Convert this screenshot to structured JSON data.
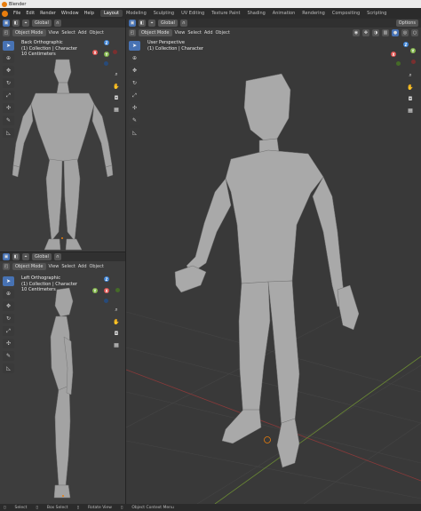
{
  "titlebar": {
    "title": "Blender"
  },
  "menu": [
    "File",
    "Edit",
    "Render",
    "Window",
    "Help"
  ],
  "workspaces": [
    "Layout",
    "Modeling",
    "Sculpting",
    "UV Editing",
    "Texture Paint",
    "Shading",
    "Animation",
    "Rendering",
    "Compositing",
    "Scripting"
  ],
  "active_workspace": "Layout",
  "header": {
    "orientation": "Global",
    "mode": "Object Mode",
    "view": "View",
    "select": "Select",
    "add": "Add",
    "object": "Object",
    "options": "Options"
  },
  "viewports": {
    "back": {
      "name": "Back Orthographic",
      "collection": "(1) Collection | Character",
      "scale": "10 Centimeters"
    },
    "left": {
      "name": "Left Orthographic",
      "collection": "(1) Collection | Character",
      "scale": "10 Centimeters"
    },
    "persp": {
      "name": "User Perspective",
      "collection": "(1) Collection | Character"
    }
  },
  "status": {
    "select": "Select",
    "box_select": "Box Select",
    "rotate_view": "Rotate View",
    "context_menu": "Object Context Menu"
  },
  "icons": {
    "select": "cursor-arrow-icon",
    "cursor": "3d-cursor-icon",
    "move": "move-icon",
    "rotate": "rotate-icon",
    "scale": "scale-icon",
    "transform": "transform-icon",
    "annotate": "annotate-icon",
    "measure": "measure-icon"
  },
  "colors": {
    "accent": "#4772b3",
    "x_axis": "#e0514f",
    "y_axis": "#82b64a",
    "z_axis": "#3c83d6",
    "viewport_bg": "#3d3d3d",
    "mesh": "#a3a3a3"
  }
}
